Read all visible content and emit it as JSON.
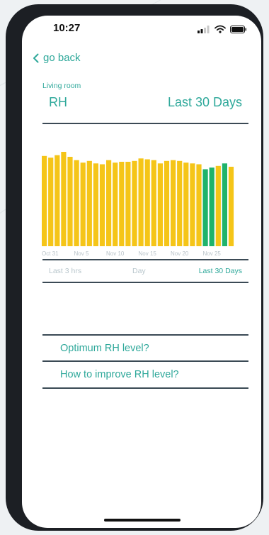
{
  "status": {
    "time": "10:27"
  },
  "nav": {
    "back_label": "go back"
  },
  "header": {
    "room": "Living room",
    "metric": "RH",
    "period": "Last 30 Days"
  },
  "range_tabs": [
    {
      "label": "Last 3 hrs",
      "active": false
    },
    {
      "label": "Day",
      "active": false
    },
    {
      "label": "Last 30 Days",
      "active": true
    }
  ],
  "faq": [
    "Optimum RH level?",
    "How to improve RH level?"
  ],
  "colors": {
    "accent": "#2ea89a",
    "bar_high": "#f5c518",
    "bar_ok": "#1fb36b",
    "inactive": "#b8c6cc"
  },
  "chart_data": {
    "type": "bar",
    "x_tick_labels": [
      "Oct 31",
      "Nov 5",
      "Nov 10",
      "Nov 15",
      "Nov 20",
      "Nov 25"
    ],
    "values": [
      109,
      107,
      110,
      114,
      108,
      104,
      101,
      103,
      100,
      99,
      104,
      101,
      102,
      102,
      103,
      106,
      105,
      104,
      100,
      103,
      104,
      103,
      101,
      100,
      99,
      93,
      95,
      97,
      100,
      96
    ],
    "status": [
      "high",
      "high",
      "high",
      "high",
      "high",
      "high",
      "high",
      "high",
      "high",
      "high",
      "high",
      "high",
      "high",
      "high",
      "high",
      "high",
      "high",
      "high",
      "high",
      "high",
      "high",
      "high",
      "high",
      "high",
      "high",
      "ok",
      "ok",
      "high",
      "ok",
      "high",
      "ok"
    ],
    "ylim": [
      0,
      120
    ],
    "grid": false,
    "legend": "none"
  }
}
